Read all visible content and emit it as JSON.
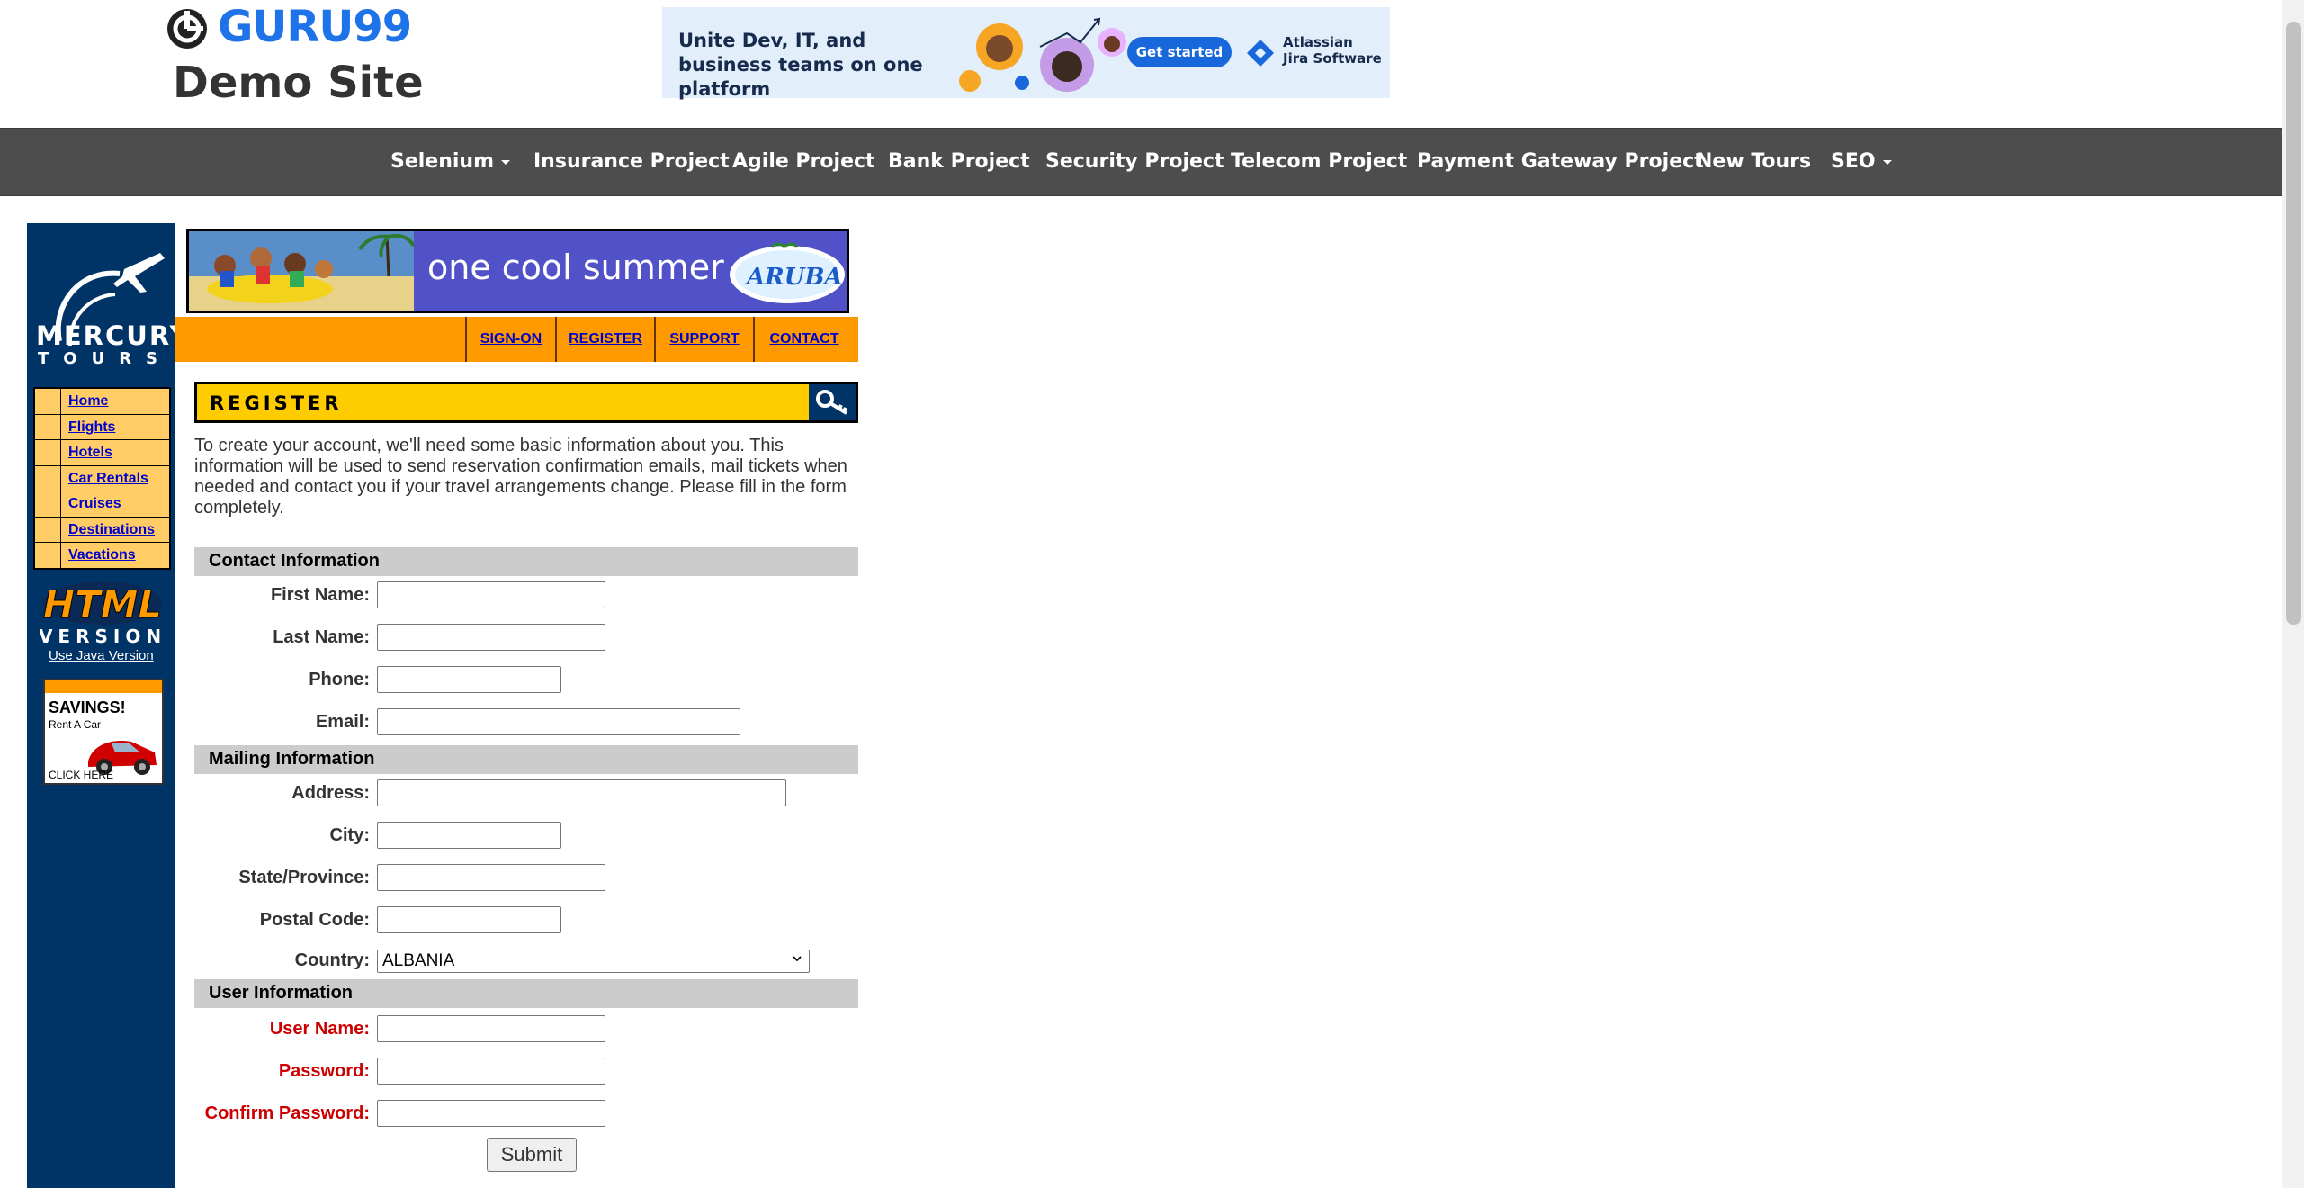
{
  "header": {
    "brand": "GURU99",
    "subtitle": "Demo Site"
  },
  "ad": {
    "headline": "Unite Dev, IT, and business teams on one platform",
    "button": "Get started",
    "product_line1": "Atlassian",
    "product_line2": "Jira Software"
  },
  "nav": {
    "items": [
      {
        "label": "Selenium",
        "dropdown": true
      },
      {
        "label": "Insurance Project"
      },
      {
        "label": "Agile Project"
      },
      {
        "label": "Bank Project"
      },
      {
        "label": "Security Project"
      },
      {
        "label": "Telecom Project"
      },
      {
        "label": "Payment Gateway Project"
      },
      {
        "label": "New Tours"
      },
      {
        "label": "SEO",
        "dropdown": true
      }
    ]
  },
  "mercury": {
    "logo_line1": "MERCURY",
    "logo_line2": "TOURS",
    "side_nav": [
      "Home",
      "Flights",
      "Hotels",
      "Car Rentals",
      "Cruises",
      "Destinations",
      "Vacations"
    ],
    "html_line1": "HTML",
    "html_line2": "VERSION",
    "java_link": "Use Java Version",
    "savings_title": "SAVINGS!",
    "savings_sub": "Rent A Car",
    "savings_click": "CLICK HERE",
    "banner_text": "one cool summer",
    "banner_badge": "ARUBA",
    "tabs": [
      "SIGN-ON",
      "REGISTER",
      "SUPPORT",
      "CONTACT"
    ],
    "page_title": "REGISTER",
    "intro": "To create your account, we'll need some basic information about you. This information will be used to send reservation confirmation emails, mail tickets when needed and contact you if your travel arrangements change. Please fill in the form completely."
  },
  "form": {
    "contact_title": "Contact Information",
    "first_name": "First Name:",
    "last_name": "Last Name:",
    "phone": "Phone:",
    "email": "Email:",
    "mailing_title": "Mailing Information",
    "address": "Address:",
    "city": "City:",
    "state": "State/Province:",
    "postal": "Postal Code:",
    "country": "Country:",
    "country_value": "ALBANIA",
    "user_title": "User Information",
    "user_name": "User Name:",
    "password": "Password:",
    "confirm_password": "Confirm Password:",
    "submit": "Submit"
  },
  "colors": {
    "brand_blue": "#1e73e8",
    "navbar": "#4d4d4d",
    "mercury_blue": "#003366",
    "orange": "#ff9900",
    "yellow": "#ffcc00",
    "required_red": "#cc0000"
  }
}
